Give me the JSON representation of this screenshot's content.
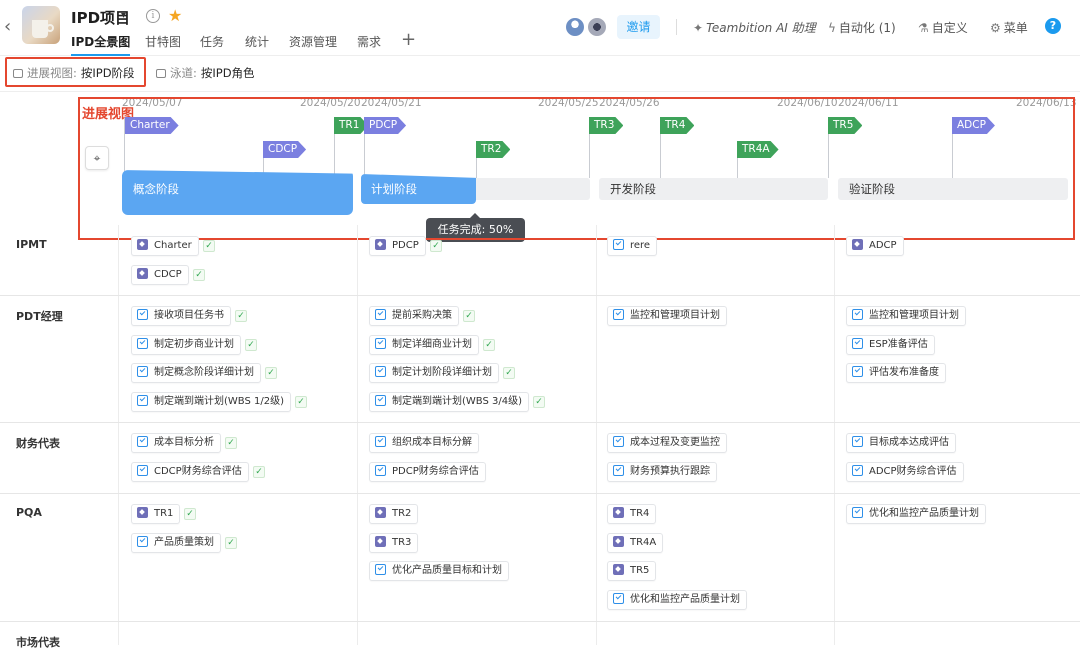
{
  "header": {
    "back_label": "‹",
    "project_title": "IPD项目",
    "title_caret": "▾",
    "info_icon": "i",
    "star_icon": "★",
    "tabs": [
      {
        "label": "IPD全景图",
        "active": true
      },
      {
        "label": "甘特图"
      },
      {
        "label": "任务"
      },
      {
        "label": "统计"
      },
      {
        "label": "资源管理"
      },
      {
        "label": "需求"
      }
    ],
    "add_tab": "+",
    "invite_label": "邀请",
    "ai_assistant": "Teambition AI 助理",
    "automation": "自动化 (1)",
    "customize": "自定义",
    "menu": "菜单",
    "help": "?"
  },
  "filters": {
    "progress_view_label": "进展视图:",
    "progress_view_value": "按IPD阶段",
    "swimlane_label": "泳道:",
    "swimlane_value": "按IPD角色"
  },
  "progress_view": {
    "annotation": "进展视图",
    "dates": [
      "2024/05/07",
      "2024/05/20",
      "2024/05/21",
      "2024/05/25",
      "2024/05/26",
      "2024/06/10",
      "2024/06/11",
      "2024/06/13"
    ],
    "milestones": [
      "Charter",
      "CDCP",
      "TR1",
      "PDCP",
      "TR2",
      "TR3",
      "TR4",
      "TR4A",
      "TR5",
      "ADCP"
    ],
    "phases": [
      "概念阶段",
      "计划阶段",
      "开发阶段",
      "验证阶段"
    ],
    "tooltip": "任务完成: 50%",
    "plan_phase_completion_percent": 50,
    "colors": {
      "milestone_dcp": "#7b7fe0",
      "milestone_tr": "#3ea35a",
      "phase_active": "#5ba6f2",
      "annotation": "#e4472f"
    }
  },
  "lanes": [
    {
      "role": "IPMT",
      "cells": [
        [
          {
            "t": "Charter",
            "k": "ms",
            "done": true
          },
          {
            "t": "CDCP",
            "k": "ms",
            "done": true
          }
        ],
        [
          {
            "t": "PDCP",
            "k": "ms",
            "done": true
          }
        ],
        [
          {
            "t": "rere",
            "k": "task"
          }
        ],
        [
          {
            "t": "ADCP",
            "k": "ms"
          }
        ]
      ]
    },
    {
      "role": "PDT经理",
      "cells": [
        [
          {
            "t": "接收项目任务书",
            "k": "task",
            "done": true
          },
          {
            "t": "制定初步商业计划",
            "k": "task",
            "done": true
          },
          {
            "t": "制定概念阶段详细计划",
            "k": "task",
            "done": true
          },
          {
            "t": "制定端到端计划(WBS 1/2级)",
            "k": "task",
            "done": true
          }
        ],
        [
          {
            "t": "提前采购决策",
            "k": "task",
            "done": true
          },
          {
            "t": "制定详细商业计划",
            "k": "task",
            "done": true
          },
          {
            "t": "制定计划阶段详细计划",
            "k": "task",
            "done": true
          },
          {
            "t": "制定端到端计划(WBS 3/4级)",
            "k": "task",
            "done": true
          }
        ],
        [
          {
            "t": "监控和管理项目计划",
            "k": "task"
          }
        ],
        [
          {
            "t": "监控和管理项目计划",
            "k": "task"
          },
          {
            "t": "ESP准备评估",
            "k": "task"
          },
          {
            "t": "评估发布准备度",
            "k": "task"
          }
        ]
      ]
    },
    {
      "role": "财务代表",
      "cells": [
        [
          {
            "t": "成本目标分析",
            "k": "task",
            "done": true
          },
          {
            "t": "CDCP财务综合评估",
            "k": "task",
            "done": true
          }
        ],
        [
          {
            "t": "组织成本目标分解",
            "k": "task"
          },
          {
            "t": "PDCP财务综合评估",
            "k": "task"
          }
        ],
        [
          {
            "t": "成本过程及变更监控",
            "k": "task"
          },
          {
            "t": "财务预算执行跟踪",
            "k": "task"
          }
        ],
        [
          {
            "t": "目标成本达成评估",
            "k": "task"
          },
          {
            "t": "ADCP财务综合评估",
            "k": "task"
          }
        ]
      ]
    },
    {
      "role": "PQA",
      "cells": [
        [
          {
            "t": "TR1",
            "k": "ms",
            "done": true
          },
          {
            "t": "产品质量策划",
            "k": "task",
            "done": true
          }
        ],
        [
          {
            "t": "TR2",
            "k": "ms"
          },
          {
            "t": "TR3",
            "k": "ms"
          },
          {
            "t": "优化产品质量目标和计划",
            "k": "task"
          }
        ],
        [
          {
            "t": "TR4",
            "k": "ms"
          },
          {
            "t": "TR4A",
            "k": "ms"
          },
          {
            "t": "TR5",
            "k": "ms"
          },
          {
            "t": "优化和监控产品质量计划",
            "k": "task"
          }
        ],
        [
          {
            "t": "优化和监控产品质量计划",
            "k": "task"
          }
        ]
      ]
    },
    {
      "role": "市场代表",
      "cells": [
        [],
        [],
        [],
        []
      ]
    }
  ]
}
